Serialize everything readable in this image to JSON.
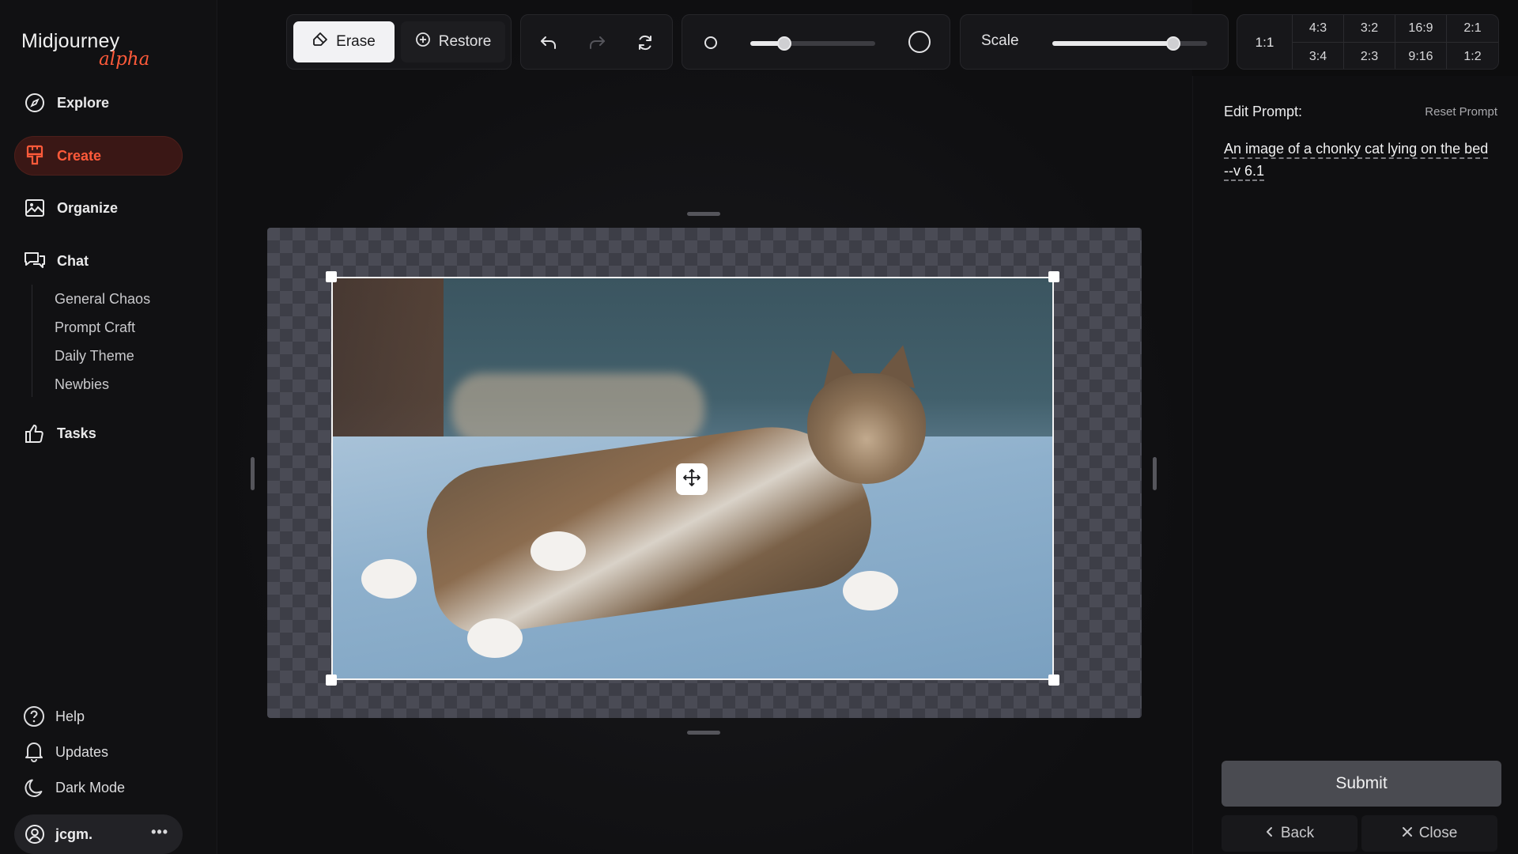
{
  "app": {
    "logo_text": "Midjourney",
    "logo_badge": "alpha",
    "accent_color": "#ff5a3a"
  },
  "sidebar": {
    "items": [
      {
        "label": "Explore",
        "icon": "compass-icon"
      },
      {
        "label": "Create",
        "icon": "brush-icon",
        "active": true
      },
      {
        "label": "Organize",
        "icon": "image-icon"
      },
      {
        "label": "Chat",
        "icon": "chat-icon"
      },
      {
        "label": "Tasks",
        "icon": "thumbs-up-icon"
      }
    ],
    "chat_channels": [
      "General Chaos",
      "Prompt Craft",
      "Daily Theme",
      "Newbies"
    ],
    "bottom": [
      {
        "label": "Help",
        "icon": "help-icon"
      },
      {
        "label": "Updates",
        "icon": "bell-icon"
      },
      {
        "label": "Dark Mode",
        "icon": "moon-icon"
      }
    ],
    "user": {
      "name": "jcgm.",
      "menu_icon": "more-icon"
    }
  },
  "toolbar": {
    "erase_label": "Erase",
    "restore_label": "Restore",
    "undo_icon": "undo-icon",
    "redo_icon": "redo-icon",
    "reset_icon": "refresh-icon",
    "brush_size_fraction": 0.27,
    "scale_label": "Scale",
    "scale_fraction": 0.78
  },
  "aspect_ratios": {
    "selected": "1:1",
    "top_row": [
      "4:3",
      "3:2",
      "16:9",
      "2:1"
    ],
    "bottom_row": [
      "3:4",
      "2:3",
      "9:16",
      "1:2"
    ]
  },
  "right_panel": {
    "edit_prompt_label": "Edit Prompt:",
    "reset_prompt_label": "Reset Prompt",
    "prompt_text": "An image of a chonky cat lying on the bed --v 6.1",
    "submit_label": "Submit",
    "back_label": "Back",
    "close_label": "Close"
  }
}
